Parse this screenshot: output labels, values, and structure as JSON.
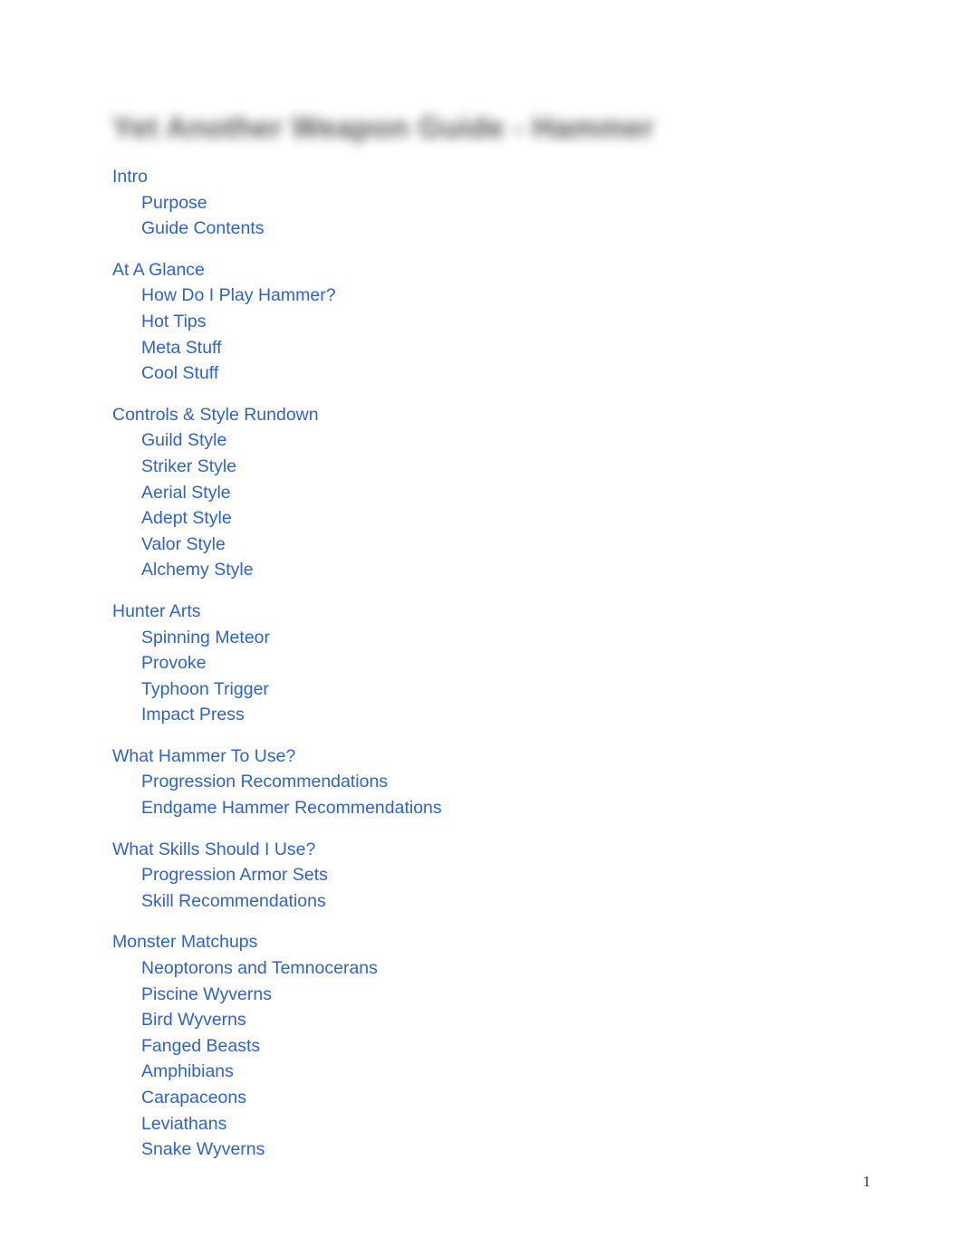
{
  "document": {
    "title": "Yet Another Weapon Guide - Hammer",
    "page_number": "1",
    "link_color": "#2f62cf",
    "background_color": "#ffffff"
  },
  "toc": {
    "groups": [
      {
        "heading": "Intro",
        "items": [
          "Purpose",
          "Guide Contents"
        ]
      },
      {
        "heading": "At A Glance",
        "items": [
          "How Do I Play Hammer?",
          "Hot Tips",
          "Meta Stuff",
          "Cool Stuff"
        ]
      },
      {
        "heading": "Controls & Style Rundown",
        "items": [
          "Guild Style",
          "Striker Style",
          "Aerial Style",
          "Adept Style",
          "Valor Style",
          "Alchemy Style"
        ]
      },
      {
        "heading": "Hunter Arts",
        "items": [
          "Spinning Meteor",
          "Provoke",
          "Typhoon Trigger",
          "Impact Press"
        ]
      },
      {
        "heading": "What Hammer To Use?",
        "items": [
          "Progression Recommendations",
          "Endgame Hammer Recommendations"
        ]
      },
      {
        "heading": "What Skills Should I Use?",
        "items": [
          "Progression Armor Sets",
          "Skill Recommendations"
        ]
      },
      {
        "heading": "Monster Matchups",
        "items": [
          "Neoptorons and Temnocerans",
          "Piscine Wyverns",
          "Bird Wyverns",
          "Fanged Beasts",
          "Amphibians",
          "Carapaceons",
          "Leviathans",
          "Snake Wyverns"
        ]
      }
    ]
  }
}
